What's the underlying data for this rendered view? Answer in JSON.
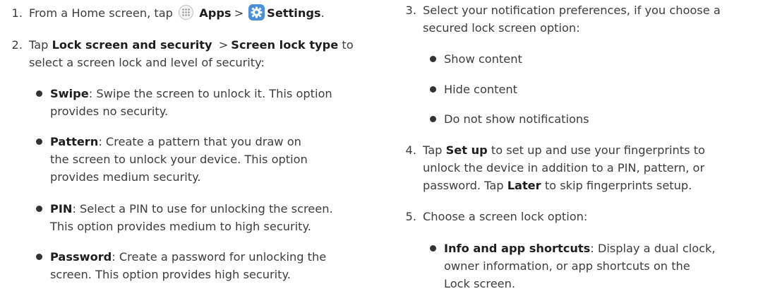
{
  "left": {
    "step1": {
      "num": "1.",
      "text1": "From a Home screen, tap",
      "apps_label": "Apps",
      "settings_label": "Settings",
      "end": ".",
      "apps_icon": "apps-grid-icon",
      "settings_icon": "settings-gear-icon"
    },
    "step2": {
      "num": "2.",
      "text1": "Tap",
      "lock_label": "Lock screen and security",
      "type_label": "Screen lock type",
      "text2": "to",
      "line2": "select a screen lock and level of security:"
    },
    "bullets": [
      {
        "label": "Swipe",
        "l1": ": Swipe the screen to unlock it. This option",
        "l2": "provides no security."
      },
      {
        "label": "Pattern",
        "l1": ": Create a pattern that you draw on",
        "l2": "the screen to unlock your device. This option",
        "l3": "provides medium security."
      },
      {
        "label": "PIN",
        "l1": ": Select a PIN to use for unlocking the screen.",
        "l2": "This option provides medium to high security."
      },
      {
        "label": "Password",
        "l1": ": Create a password for unlocking the",
        "l2": "screen. This option provides high security."
      }
    ]
  },
  "right": {
    "step3": {
      "num": "3.",
      "l1": "Select your notification preferences, if you choose a",
      "l2": "secured lock screen option:"
    },
    "notif_bullets": [
      "Show content",
      "Hide content",
      "Do not show notifications"
    ],
    "step4": {
      "num": "4.",
      "t1": "Tap",
      "setup_label": "Set up",
      "t2": "to set up and use your fingerprints to",
      "l2": "unlock the device in addition to a PIN, pattern, or",
      "t3": "password. Tap",
      "later_label": "Later",
      "t4": "to skip fingerprints setup."
    },
    "step5": {
      "num": "5.",
      "text": "Choose a screen lock option:"
    },
    "info_bullet": {
      "label": "Info and app shortcuts",
      "l1": ": Display a dual clock,",
      "l2": "owner information, or app shortcuts on the",
      "l3": "Lock screen."
    }
  }
}
